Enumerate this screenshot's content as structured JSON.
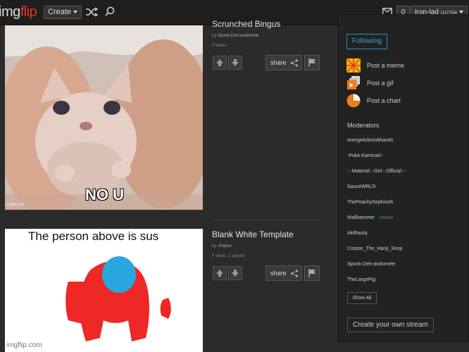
{
  "topbar": {
    "logo_a": "img",
    "logo_b": "flip",
    "create_label": "Create",
    "notification_count": "0",
    "username": "Iron-lad",
    "user_points": "(117754)"
  },
  "posts": [
    {
      "title": "Scrunched Bingus",
      "by": "by",
      "author": "Sponk-Deh-andomele",
      "stats": "0 views",
      "share_label": "share",
      "caption": "NO U",
      "watermark": "imgflip.com"
    },
    {
      "title": "Blank White Template",
      "by": "by",
      "author": "-Raptor-",
      "stats": "0 views, 1 upvote",
      "share_label": "share",
      "caption": "The person above is sus",
      "watermark": "imgflip.com"
    }
  ],
  "sidebar": {
    "following_label": "Following",
    "post_meme": "Post a meme",
    "post_gif": "Post a gif",
    "post_chart": "Post a chart",
    "moderators_title": "Moderators",
    "moderators": [
      "energeticbombhands",
      "-Poke.Kaminari-",
      "-.-Material-.-Girl-.-Official-.-",
      "SauceWRLD",
      "ThePeachySephiroth",
      "Wallhammer",
      "Akifhaziq",
      "Corpse_The_Hanji_Simp",
      "Sponk-Deh-andomele",
      "TheLargePig"
    ],
    "owner_badge": "OWNER",
    "show_all": "Show All",
    "create_stream": "Create your own stream"
  },
  "colors": {
    "brand_red": "#e0392b",
    "following_blue": "#3aa0d8",
    "owner_green": "#4caf50",
    "amogus_red": "#ee2727",
    "amogus_visor": "#29a8e0"
  }
}
